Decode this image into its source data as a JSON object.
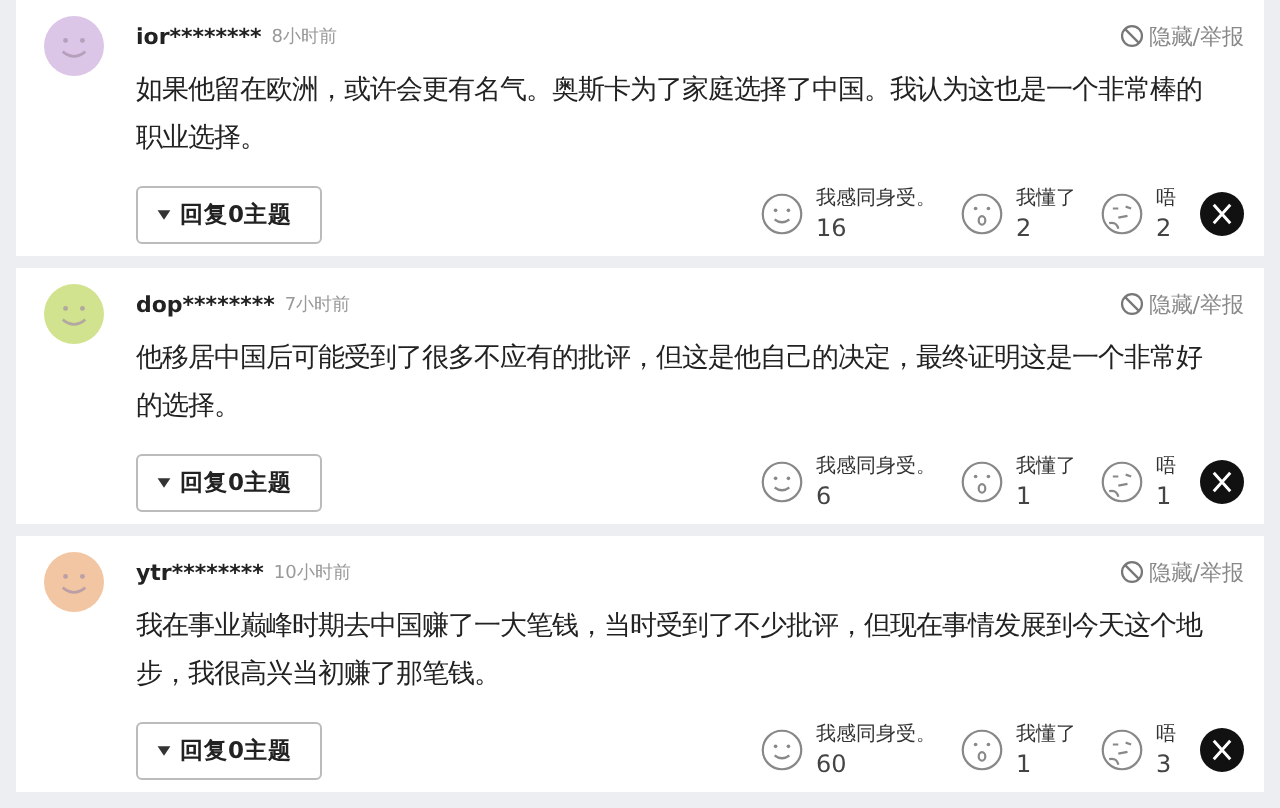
{
  "comments": [
    {
      "color": "#dcc6e8",
      "user": "ior********",
      "time": "8小时前",
      "hide_report": "隐藏/举报",
      "text": "如果他留在欧洲，或许会更有名气。奥斯卡为了家庭选择了中国。我认为这也是一个非常棒的职业选择。",
      "reply": "回复0主题",
      "reactions": [
        {
          "kind": "smile",
          "label": "我感同身受。",
          "count": "16"
        },
        {
          "kind": "surprised",
          "label": "我懂了",
          "count": "2"
        },
        {
          "kind": "thinking",
          "label": "唔",
          "count": "2"
        }
      ]
    },
    {
      "color": "#d2e38f",
      "user": "dop********",
      "time": "7小时前",
      "hide_report": "隐藏/举报",
      "text": "他移居中国后可能受到了很多不应有的批评，但这是他自己的决定，最终证明这是一个非常好的选择。",
      "reply": "回复0主题",
      "reactions": [
        {
          "kind": "smile",
          "label": "我感同身受。",
          "count": "6"
        },
        {
          "kind": "surprised",
          "label": "我懂了",
          "count": "1"
        },
        {
          "kind": "thinking",
          "label": "唔",
          "count": "1"
        }
      ]
    },
    {
      "color": "#f2c6a2",
      "user": "ytr********",
      "time": "10小时前",
      "hide_report": "隐藏/举报",
      "text": "我在事业巅峰时期去中国赚了一大笔钱，当时受到了不少批评，但现在事情发展到今天这个地步，我很高兴当初赚了那笔钱。",
      "reply": "回复0主题",
      "reactions": [
        {
          "kind": "smile",
          "label": "我感同身受。",
          "count": "60"
        },
        {
          "kind": "surprised",
          "label": "我懂了",
          "count": "1"
        },
        {
          "kind": "thinking",
          "label": "唔",
          "count": "3"
        }
      ]
    }
  ]
}
